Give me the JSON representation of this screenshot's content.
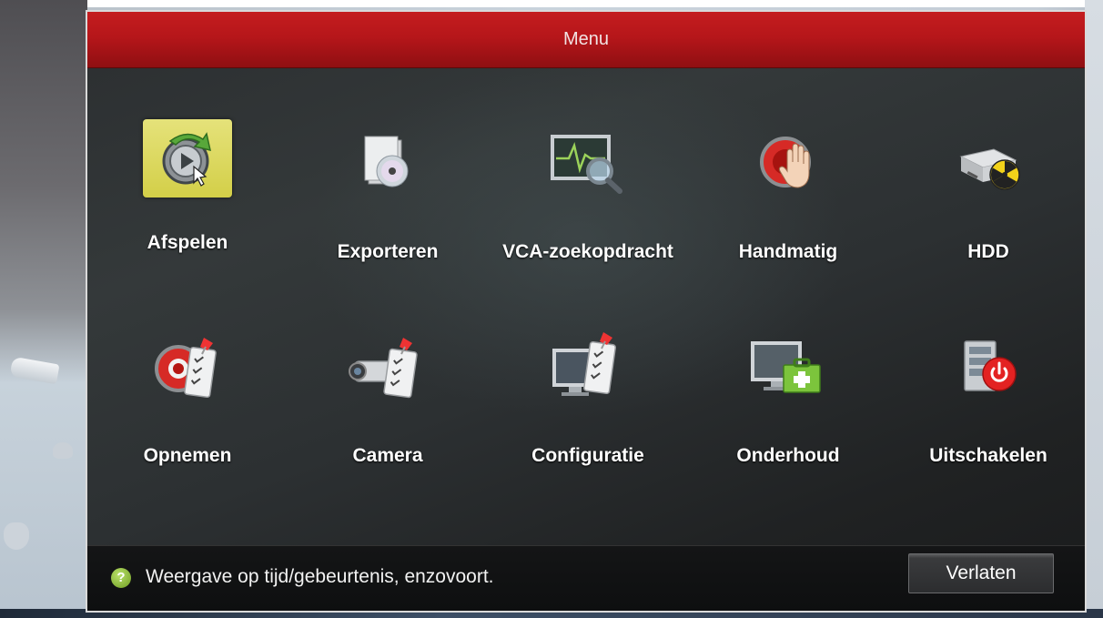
{
  "window": {
    "title": "Menu"
  },
  "menu": {
    "items": [
      {
        "label": "Afspelen",
        "icon": "playback-icon",
        "selected": true
      },
      {
        "label": "Exporteren",
        "icon": "export-icon",
        "selected": false
      },
      {
        "label": "VCA-zoekopdracht",
        "icon": "vca-search-icon",
        "selected": false
      },
      {
        "label": "Handmatig",
        "icon": "manual-record-icon",
        "selected": false
      },
      {
        "label": "HDD",
        "icon": "hdd-icon",
        "selected": false
      },
      {
        "label": "Opnemen",
        "icon": "record-icon",
        "selected": false
      },
      {
        "label": "Camera",
        "icon": "camera-icon",
        "selected": false
      },
      {
        "label": "Configuratie",
        "icon": "configuration-icon",
        "selected": false
      },
      {
        "label": "Onderhoud",
        "icon": "maintenance-icon",
        "selected": false
      },
      {
        "label": "Uitschakelen",
        "icon": "shutdown-icon",
        "selected": false
      }
    ]
  },
  "footer": {
    "help_icon": "help-icon",
    "help_glyph": "?",
    "help_text": "Weergave op tijd/gebeurtenis, enzovoort.",
    "exit_label": "Verlaten"
  },
  "colors": {
    "title_bar": "#b6161a",
    "selected_tile": "#d3cf48",
    "help_icon": "#8bc34a",
    "shutdown_red": "#e32222"
  }
}
